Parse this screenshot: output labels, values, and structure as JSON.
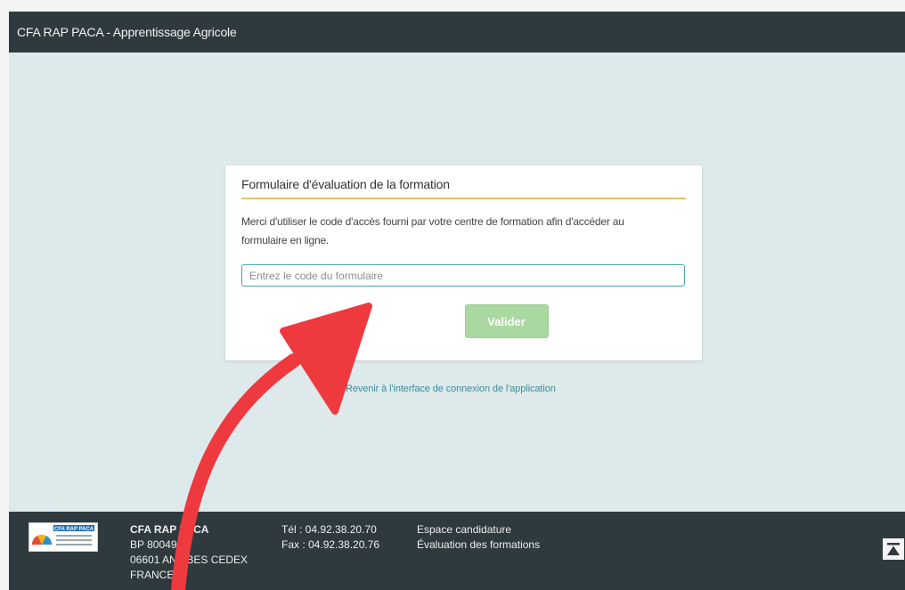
{
  "header": {
    "title": "CFA RAP PACA - Apprentissage Agricole"
  },
  "card": {
    "title": "Formulaire d'évaluation de la formation",
    "instructions": "Merci d'utiliser le code d'accès fourni par votre centre de formation afin d'accéder au formulaire en ligne.",
    "code_placeholder": "Entrez le code du formulaire",
    "code_value": "",
    "submit_label": "Valider"
  },
  "back_link": "Revenir à l'interface de connexion de l'application",
  "footer": {
    "logo_text": "CFA RAP PACA",
    "address": {
      "org": "CFA RAP PACA",
      "line1": "BP 80049",
      "line2": "06601 ANTIBES CEDEX",
      "line3": "FRANCE"
    },
    "contact": {
      "phone": "Tél : 04.92.38.20.70",
      "fax": "Fax : 04.92.38.20.76"
    },
    "links": [
      "Espace candidature",
      "Évaluation des formations"
    ]
  },
  "icons": {
    "scroll_top": "arrow-to-top-icon"
  },
  "colors": {
    "header_bg": "#2f3a3e",
    "page_bg": "#dde9ea",
    "accent_underline": "#f5c05a",
    "button_bg": "#a9d9a0",
    "link": "#3d8e98",
    "annotation_arrow": "#ee3a3f"
  }
}
